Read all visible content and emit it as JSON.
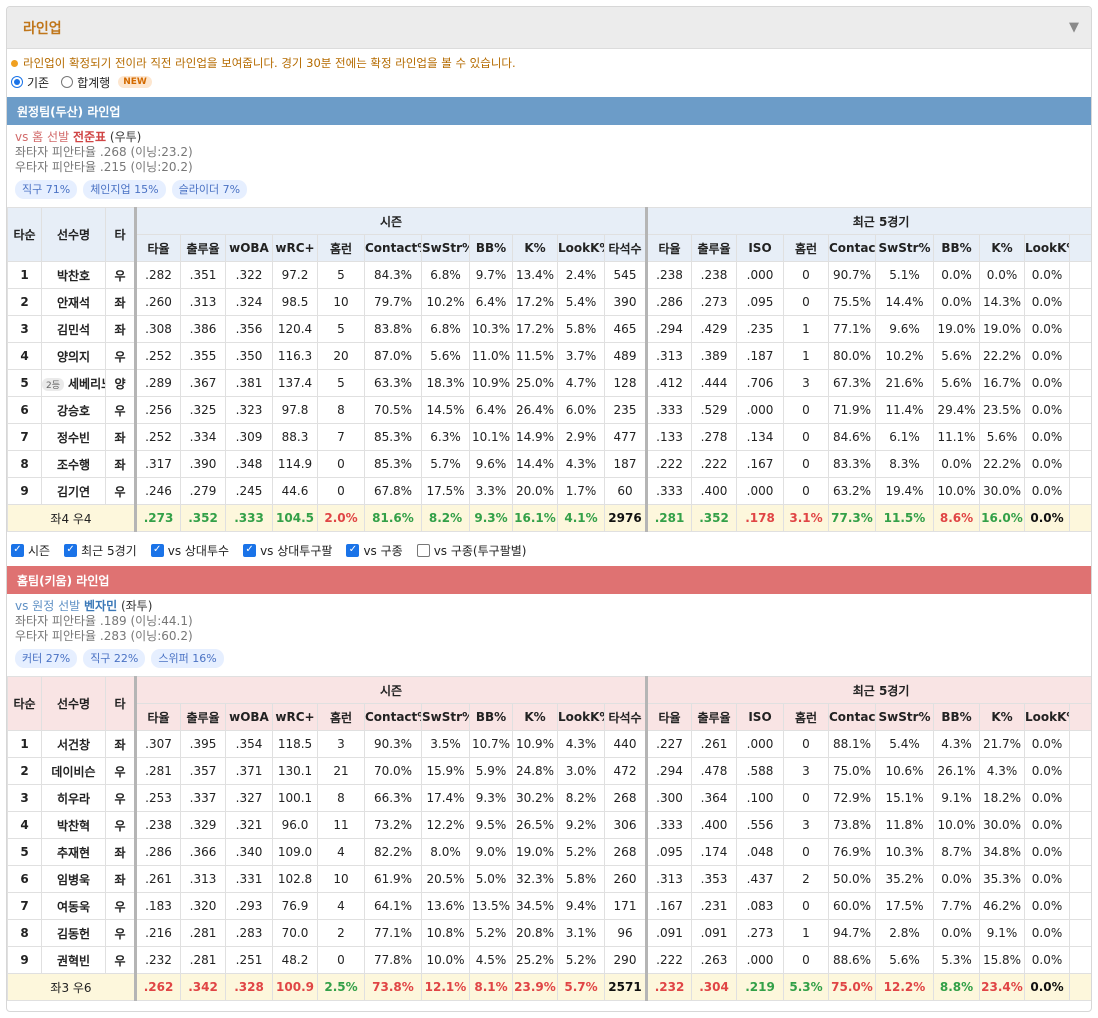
{
  "panel": {
    "title": "라인업",
    "collapse_icon": "triangle-down-icon"
  },
  "notice": "라인업이 확정되기 전이라 직전 라인업을 보여줍니다. 경기 30분 전에는 확정 라인업을 볼 수 있습니다.",
  "modes": {
    "standard": "기존",
    "combined": "합계행",
    "new_badge": "NEW",
    "selected": "기존"
  },
  "columns": {
    "order": "타순",
    "name": "선수명",
    "hand": "타",
    "season_group": "시즌",
    "recent_group": "최근 5경기",
    "season": [
      "타율",
      "출루율",
      "wOBA",
      "wRC+",
      "홈런",
      "Contact%",
      "SwStr%",
      "BB%",
      "K%",
      "LookK%",
      "타석수"
    ],
    "recent": [
      "타율",
      "출루율",
      "ISO",
      "홈런",
      "Contact%",
      "SwStr%",
      "BB%",
      "K%",
      "LookK%"
    ]
  },
  "away": {
    "title": "원정팀(두산) 라인업",
    "vs_prefix": "vs 홈 선발",
    "pitcher": "전준표",
    "pitcher_hand": "(우투)",
    "vs_left": "좌타자 피안타율 .268 (이닝:23.2)",
    "vs_right": "우타자 피안타율 .215 (이닝:20.2)",
    "pitches": [
      "직구 71%",
      "체인지업 15%",
      "슬라이더 7%"
    ],
    "rows": [
      {
        "order": "1",
        "name": "박찬호",
        "badge": "",
        "hand": "우",
        "season": [
          ".282",
          ".351",
          ".322",
          "97.2",
          "5",
          "84.3%",
          "6.8%",
          "9.7%",
          "13.4%",
          "2.4%",
          "545"
        ],
        "recent": [
          ".238",
          ".238",
          ".000",
          "0",
          "90.7%",
          "5.1%",
          "0.0%",
          "0.0%",
          "0.0%"
        ]
      },
      {
        "order": "2",
        "name": "안재석",
        "badge": "",
        "hand": "좌",
        "season": [
          ".260",
          ".313",
          ".324",
          "98.5",
          "10",
          "79.7%",
          "10.2%",
          "6.4%",
          "17.2%",
          "5.4%",
          "390"
        ],
        "recent": [
          ".286",
          ".273",
          ".095",
          "0",
          "75.5%",
          "14.4%",
          "0.0%",
          "14.3%",
          "0.0%"
        ]
      },
      {
        "order": "3",
        "name": "김민석",
        "badge": "",
        "hand": "좌",
        "season": [
          ".308",
          ".386",
          ".356",
          "120.4",
          "5",
          "83.8%",
          "6.8%",
          "10.3%",
          "17.2%",
          "5.8%",
          "465"
        ],
        "recent": [
          ".294",
          ".429",
          ".235",
          "1",
          "77.1%",
          "9.6%",
          "19.0%",
          "19.0%",
          "0.0%"
        ]
      },
      {
        "order": "4",
        "name": "양의지",
        "badge": "",
        "hand": "우",
        "season": [
          ".252",
          ".355",
          ".350",
          "116.3",
          "20",
          "87.0%",
          "5.6%",
          "11.0%",
          "11.5%",
          "3.7%",
          "489"
        ],
        "recent": [
          ".313",
          ".389",
          ".187",
          "1",
          "80.0%",
          "10.2%",
          "5.6%",
          "22.2%",
          "0.0%"
        ]
      },
      {
        "order": "5",
        "name": "세베리노",
        "badge": "2등",
        "hand": "양",
        "season": [
          ".289",
          ".367",
          ".381",
          "137.4",
          "5",
          "63.3%",
          "18.3%",
          "10.9%",
          "25.0%",
          "4.7%",
          "128"
        ],
        "recent": [
          ".412",
          ".444",
          ".706",
          "3",
          "67.3%",
          "21.6%",
          "5.6%",
          "16.7%",
          "0.0%"
        ]
      },
      {
        "order": "6",
        "name": "강승호",
        "badge": "",
        "hand": "우",
        "season": [
          ".256",
          ".325",
          ".323",
          "97.8",
          "8",
          "70.5%",
          "14.5%",
          "6.4%",
          "26.4%",
          "6.0%",
          "235"
        ],
        "recent": [
          ".333",
          ".529",
          ".000",
          "0",
          "71.9%",
          "11.4%",
          "29.4%",
          "23.5%",
          "0.0%"
        ]
      },
      {
        "order": "7",
        "name": "정수빈",
        "badge": "",
        "hand": "좌",
        "season": [
          ".252",
          ".334",
          ".309",
          "88.3",
          "7",
          "85.3%",
          "6.3%",
          "10.1%",
          "14.9%",
          "2.9%",
          "477"
        ],
        "recent": [
          ".133",
          ".278",
          ".134",
          "0",
          "84.6%",
          "6.1%",
          "11.1%",
          "5.6%",
          "0.0%"
        ]
      },
      {
        "order": "8",
        "name": "조수행",
        "badge": "",
        "hand": "좌",
        "season": [
          ".317",
          ".390",
          ".348",
          "114.9",
          "0",
          "85.3%",
          "5.7%",
          "9.6%",
          "14.4%",
          "4.3%",
          "187"
        ],
        "recent": [
          ".222",
          ".222",
          ".167",
          "0",
          "83.3%",
          "8.3%",
          "0.0%",
          "22.2%",
          "0.0%"
        ]
      },
      {
        "order": "9",
        "name": "김기연",
        "badge": "",
        "hand": "우",
        "season": [
          ".246",
          ".279",
          ".245",
          "44.6",
          "0",
          "67.8%",
          "17.5%",
          "3.3%",
          "20.0%",
          "1.7%",
          "60"
        ],
        "recent": [
          ".333",
          ".400",
          ".000",
          "0",
          "63.2%",
          "19.4%",
          "10.0%",
          "30.0%",
          "0.0%"
        ]
      }
    ],
    "summary": {
      "label": "좌4 우4",
      "season": [
        ".273",
        ".352",
        ".333",
        "104.5",
        "2.0%",
        "81.6%",
        "8.2%",
        "9.3%",
        "16.1%",
        "4.1%",
        "2976"
      ],
      "season_colors": [
        "g",
        "g",
        "g",
        "g",
        "r",
        "g",
        "g",
        "g",
        "g",
        "g",
        "k"
      ],
      "recent": [
        ".281",
        ".352",
        ".178",
        "3.1%",
        "77.3%",
        "11.5%",
        "8.6%",
        "16.0%",
        "0.0%"
      ],
      "recent_colors": [
        "g",
        "g",
        "r",
        "r",
        "g",
        "g",
        "r",
        "g",
        "k"
      ]
    }
  },
  "filters": [
    {
      "label": "시즌",
      "checked": true
    },
    {
      "label": "최근 5경기",
      "checked": true
    },
    {
      "label": "vs 상대투수",
      "checked": true
    },
    {
      "label": "vs 상대투구팔",
      "checked": true
    },
    {
      "label": "vs 구종",
      "checked": true
    },
    {
      "label": "vs 구종(투구팔별)",
      "checked": false
    }
  ],
  "home": {
    "title": "홈팀(키움) 라인업",
    "vs_prefix": "vs 원정 선발",
    "pitcher": "벤자민",
    "pitcher_hand": "(좌투)",
    "vs_left": "좌타자 피안타율 .189 (이닝:44.1)",
    "vs_right": "우타자 피안타율 .283 (이닝:60.2)",
    "pitches": [
      "커터 27%",
      "직구 22%",
      "스위퍼 16%"
    ],
    "rows": [
      {
        "order": "1",
        "name": "서건창",
        "badge": "",
        "hand": "좌",
        "season": [
          ".307",
          ".395",
          ".354",
          "118.5",
          "3",
          "90.3%",
          "3.5%",
          "10.7%",
          "10.9%",
          "4.3%",
          "440"
        ],
        "recent": [
          ".227",
          ".261",
          ".000",
          "0",
          "88.1%",
          "5.4%",
          "4.3%",
          "21.7%",
          "0.0%"
        ]
      },
      {
        "order": "2",
        "name": "데이비슨",
        "badge": "",
        "hand": "우",
        "season": [
          ".281",
          ".357",
          ".371",
          "130.1",
          "21",
          "70.0%",
          "15.9%",
          "5.9%",
          "24.8%",
          "3.0%",
          "472"
        ],
        "recent": [
          ".294",
          ".478",
          ".588",
          "3",
          "75.0%",
          "10.6%",
          "26.1%",
          "4.3%",
          "0.0%"
        ]
      },
      {
        "order": "3",
        "name": "히우라",
        "badge": "",
        "hand": "우",
        "season": [
          ".253",
          ".337",
          ".327",
          "100.1",
          "8",
          "66.3%",
          "17.4%",
          "9.3%",
          "30.2%",
          "8.2%",
          "268"
        ],
        "recent": [
          ".300",
          ".364",
          ".100",
          "0",
          "72.9%",
          "15.1%",
          "9.1%",
          "18.2%",
          "0.0%"
        ]
      },
      {
        "order": "4",
        "name": "박찬혁",
        "badge": "",
        "hand": "우",
        "season": [
          ".238",
          ".329",
          ".321",
          "96.0",
          "11",
          "73.2%",
          "12.2%",
          "9.5%",
          "26.5%",
          "9.2%",
          "306"
        ],
        "recent": [
          ".333",
          ".400",
          ".556",
          "3",
          "73.8%",
          "11.8%",
          "10.0%",
          "30.0%",
          "0.0%"
        ]
      },
      {
        "order": "5",
        "name": "추재현",
        "badge": "",
        "hand": "좌",
        "season": [
          ".286",
          ".366",
          ".340",
          "109.0",
          "4",
          "82.2%",
          "8.0%",
          "9.0%",
          "19.0%",
          "5.2%",
          "268"
        ],
        "recent": [
          ".095",
          ".174",
          ".048",
          "0",
          "76.9%",
          "10.3%",
          "8.7%",
          "34.8%",
          "0.0%"
        ]
      },
      {
        "order": "6",
        "name": "임병욱",
        "badge": "",
        "hand": "좌",
        "season": [
          ".261",
          ".313",
          ".331",
          "102.8",
          "10",
          "61.9%",
          "20.5%",
          "5.0%",
          "32.3%",
          "5.8%",
          "260"
        ],
        "recent": [
          ".313",
          ".353",
          ".437",
          "2",
          "50.0%",
          "35.2%",
          "0.0%",
          "35.3%",
          "0.0%"
        ]
      },
      {
        "order": "7",
        "name": "여동욱",
        "badge": "",
        "hand": "우",
        "season": [
          ".183",
          ".320",
          ".293",
          "76.9",
          "4",
          "64.1%",
          "13.6%",
          "13.5%",
          "34.5%",
          "9.4%",
          "171"
        ],
        "recent": [
          ".167",
          ".231",
          ".083",
          "0",
          "60.0%",
          "17.5%",
          "7.7%",
          "46.2%",
          "0.0%"
        ]
      },
      {
        "order": "8",
        "name": "김동헌",
        "badge": "",
        "hand": "우",
        "season": [
          ".216",
          ".281",
          ".283",
          "70.0",
          "2",
          "77.1%",
          "10.8%",
          "5.2%",
          "20.8%",
          "3.1%",
          "96"
        ],
        "recent": [
          ".091",
          ".091",
          ".273",
          "1",
          "94.7%",
          "2.8%",
          "0.0%",
          "9.1%",
          "0.0%"
        ]
      },
      {
        "order": "9",
        "name": "권혁빈",
        "badge": "",
        "hand": "우",
        "season": [
          ".232",
          ".281",
          ".251",
          "48.2",
          "0",
          "77.8%",
          "10.0%",
          "4.5%",
          "25.2%",
          "5.2%",
          "290"
        ],
        "recent": [
          ".222",
          ".263",
          ".000",
          "0",
          "88.6%",
          "5.6%",
          "5.3%",
          "15.8%",
          "0.0%"
        ]
      }
    ],
    "summary": {
      "label": "좌3 우6",
      "season": [
        ".262",
        ".342",
        ".328",
        "100.9",
        "2.5%",
        "73.8%",
        "12.1%",
        "8.1%",
        "23.9%",
        "5.7%",
        "2571"
      ],
      "season_colors": [
        "r",
        "r",
        "r",
        "r",
        "g",
        "r",
        "r",
        "r",
        "r",
        "r",
        "k"
      ],
      "recent": [
        ".232",
        ".304",
        ".219",
        "5.3%",
        "75.0%",
        "12.2%",
        "8.8%",
        "23.4%",
        "0.0%"
      ],
      "recent_colors": [
        "r",
        "r",
        "g",
        "g",
        "r",
        "r",
        "g",
        "r",
        "k"
      ]
    }
  },
  "colors": {
    "away_bar": "#6c9cc8",
    "home_bar": "#df7272",
    "title": "#c0761a",
    "good": "#33a048",
    "bad": "#e04545"
  }
}
